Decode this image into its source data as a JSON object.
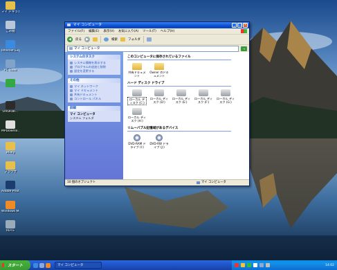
{
  "desktop_icons": [
    {
      "label": "マイ ドキュメント",
      "icon": "my-documents-icon",
      "color": "#e6c04a"
    },
    {
      "label": "ごみ箱",
      "icon": "recycle-bin-icon",
      "color": "#b9c7d8"
    },
    {
      "label": "Internet Explorer",
      "icon": "internet-explorer-icon",
      "color": "#3a8be0"
    },
    {
      "label": "PC Tools",
      "icon": "pc-tools-icon",
      "color": "#7fa3c9"
    },
    {
      "label": "",
      "icon": "green-app-icon",
      "color": "#34a845"
    },
    {
      "label": "DVDFab...",
      "icon": "dvdfab-icon",
      "color": "#2c2c2c"
    },
    {
      "label": "MPDownlo...",
      "icon": "mpdownloader-icon",
      "color": "#e0e0e0"
    },
    {
      "label": "utility",
      "icon": "folder-icon",
      "color": "#e6c04a"
    },
    {
      "label": "プラウザ",
      "icon": "folder-icon",
      "color": "#e6c04a"
    },
    {
      "label": "Adobe Photosh...",
      "icon": "photoshop-icon",
      "color": "#1b3c6e"
    },
    {
      "label": "Windows Media Player",
      "icon": "media-player-icon",
      "color": "#f08a24"
    },
    {
      "label": "RDTE",
      "icon": "app-icon",
      "color": "#9ab"
    }
  ],
  "window": {
    "title": "マイ コンピュータ",
    "menu": [
      "ファイル(F)",
      "編集(E)",
      "表示(V)",
      "お気に入り(A)",
      "ツール(T)",
      "ヘルプ(H)"
    ],
    "toolbar": {
      "back": "戻る",
      "search": "検索",
      "folders": "フォルダ"
    },
    "address": "マイ コンピュータ",
    "task_panels": [
      {
        "title": "システムのタスク",
        "items": [
          "システム情報を表示する",
          "プログラムの追加と削除",
          "設定を変更する"
        ]
      },
      {
        "title": "その他",
        "items": [
          "マイ ネットワーク",
          "マイ ドキュメント",
          "共有ドキュメント",
          "コントロール パネル"
        ]
      }
    ],
    "details": {
      "title": "詳細",
      "name": "マイ コンピュータ",
      "sub": "システム フォルダ"
    },
    "groups": [
      {
        "heading": "このコンピュータに保存されているファイル",
        "items": [
          {
            "label": "共有ドキュメント",
            "icon": "folder-icon"
          },
          {
            "label": "Owner のドキュメント",
            "icon": "folder-icon"
          }
        ]
      },
      {
        "heading": "ハード ディスク ドライブ",
        "items": [
          {
            "label": "ローカル ディスク (C:)",
            "icon": "hard-disk-icon"
          },
          {
            "label": "ローカル ディスク (D:)",
            "icon": "hard-disk-icon"
          },
          {
            "label": "ローカル ディスク (E:)",
            "icon": "hard-disk-icon"
          },
          {
            "label": "ローカル ディスク (F:)",
            "icon": "hard-disk-icon"
          },
          {
            "label": "ローカル ディスク (G:)",
            "icon": "hard-disk-icon"
          },
          {
            "label": "ローカル ディスク (H:)",
            "icon": "hard-disk-icon"
          }
        ]
      },
      {
        "heading": "リムーバブル記憶域があるデバイス",
        "items": [
          {
            "label": "DVD-RAM ドライブ (I:)",
            "icon": "dvd-drive-icon"
          },
          {
            "label": "DVD-RW ドライブ (J:)",
            "icon": "dvd-drive-icon"
          }
        ]
      }
    ],
    "status": {
      "left": "10 個のオブジェクト",
      "right": "マイ コンピュータ"
    }
  },
  "taskbar": {
    "start": "スタート",
    "task": "マイ コンピュータ",
    "clock": "14:02"
  }
}
